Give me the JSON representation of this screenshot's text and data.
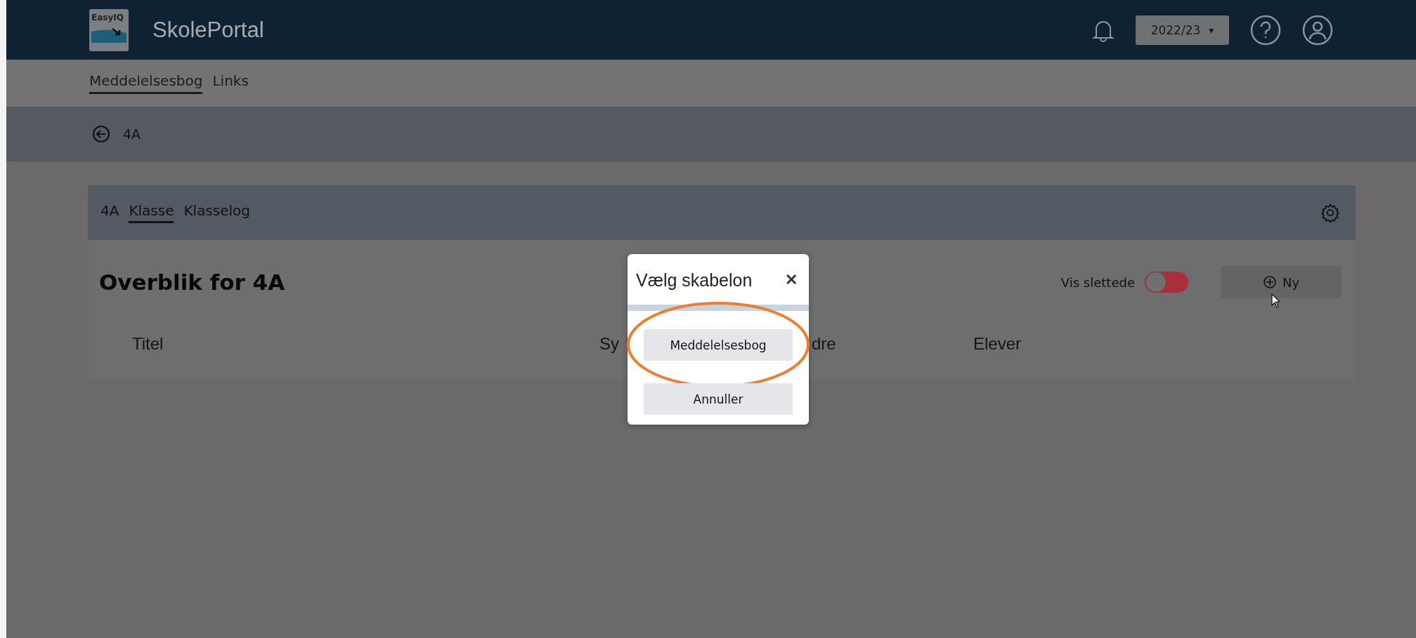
{
  "header": {
    "logo_text": "EasyIQ",
    "app_name": "SkolePortal",
    "year_select": {
      "value": "2022/23",
      "caret": "▾"
    }
  },
  "nav": {
    "items": [
      {
        "label": "Meddelelsesbog",
        "selected": true
      },
      {
        "label": "Links",
        "selected": false
      }
    ]
  },
  "breadcrumb": {
    "label": "4A"
  },
  "card": {
    "tabs": [
      {
        "label": "4A",
        "selected": false
      },
      {
        "label": "Klasse",
        "selected": true
      },
      {
        "label": "Klasselog",
        "selected": false
      }
    ],
    "title": "Overblik for 4A",
    "show_deleted": {
      "label": "Vis slettede",
      "on": false
    },
    "new_button": "Ny",
    "columns": [
      "Titel",
      "Sy",
      "dre",
      "Elever"
    ]
  },
  "dialog": {
    "title": "Vælg skabelon",
    "close": "✕",
    "buttons": [
      {
        "label": "Meddelelsesbog",
        "highlighted": true
      },
      {
        "label": "Annuller",
        "highlighted": false
      }
    ]
  }
}
